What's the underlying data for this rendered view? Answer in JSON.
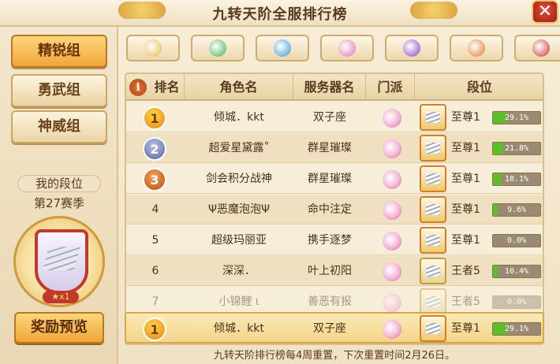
{
  "header": {
    "title": "九转天阶全服排行榜",
    "close_label": "✕"
  },
  "left": {
    "tabs": [
      "精锐组",
      "勇武组",
      "神威组"
    ],
    "active_tab": "精锐组",
    "my_rank_label": "我的段位",
    "season": "第27赛季",
    "medal_stars": "★x1",
    "reward_button": "奖励预览"
  },
  "filters": [
    {
      "name": "sect-1",
      "color": "#e7b73a"
    },
    {
      "name": "sect-2",
      "color": "#3fae4f"
    },
    {
      "name": "sect-3",
      "color": "#2e9ad8"
    },
    {
      "name": "sect-4",
      "color": "#e46fb0"
    },
    {
      "name": "sect-5",
      "color": "#8a3fc7"
    },
    {
      "name": "sect-6",
      "color": "#e1742a"
    },
    {
      "name": "sect-7",
      "color": "#c9302c"
    }
  ],
  "table": {
    "headers": {
      "info": "i",
      "rank": "排名",
      "name": "角色名",
      "server": "服务器名",
      "sect": "门派",
      "tier": "段位"
    },
    "rows": [
      {
        "rank": "1",
        "name": "倾城．kkt",
        "server": "双子座",
        "tier": "至尊1",
        "progress": 0.291,
        "progress_label": "29.1%",
        "tier_type": "supreme"
      },
      {
        "rank": "2",
        "name": "超爱星黛露˚",
        "server": "群星璀璨",
        "tier": "至尊1",
        "progress": 0.218,
        "progress_label": "21.8%",
        "tier_type": "supreme"
      },
      {
        "rank": "3",
        "name": "剑会积分战神",
        "server": "群星璀璨",
        "tier": "至尊1",
        "progress": 0.181,
        "progress_label": "18.1%",
        "tier_type": "supreme"
      },
      {
        "rank": "4",
        "name": "Ψ恶魔泡泡Ψ",
        "server": "命中注定",
        "tier": "至尊1",
        "progress": 0.096,
        "progress_label": "9.6%",
        "tier_type": "supreme"
      },
      {
        "rank": "5",
        "name": "超级玛丽亚",
        "server": "携手逐梦",
        "tier": "至尊1",
        "progress": 0.0,
        "progress_label": "0.0%",
        "tier_type": "supreme"
      },
      {
        "rank": "6",
        "name": "深深．",
        "server": "叶上初阳",
        "tier": "王者5",
        "progress": 0.104,
        "progress_label": "10.4%",
        "tier_type": "king"
      },
      {
        "rank": "7",
        "name": "小锦鲤 ι",
        "server": "善恶有报",
        "tier": "王者5",
        "progress": 0.0,
        "progress_label": "0.0%",
        "tier_type": "king"
      }
    ]
  },
  "my_row": {
    "rank": "1",
    "name": "倾城．kkt",
    "server": "双子座",
    "tier": "至尊1",
    "progress": 0.291,
    "progress_label": "29.1%"
  },
  "footer": "九转天阶排行榜每4周重置，下次重置时间2月26日。"
}
